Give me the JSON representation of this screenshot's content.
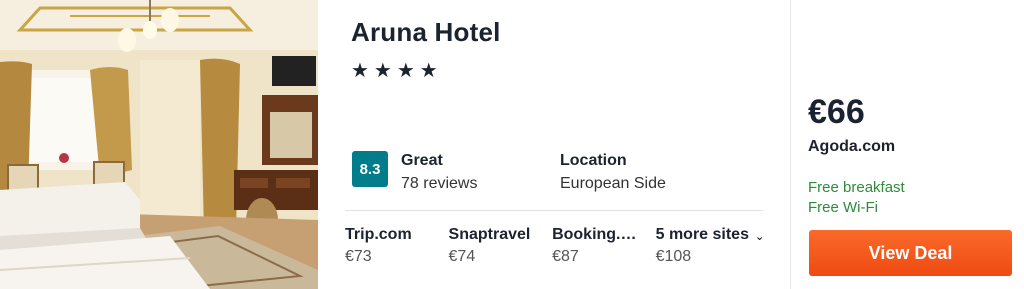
{
  "hotel": {
    "name": "Aruna Hotel",
    "stars_text": "★★★★",
    "star_count": 4
  },
  "rating": {
    "score": "8.3",
    "label": "Great",
    "reviews": "78 reviews",
    "badge_color": "#007c8b"
  },
  "location": {
    "title": "Location",
    "value": "European Side"
  },
  "sites": [
    {
      "name": "Trip.com",
      "price": "€73"
    },
    {
      "name": "Snaptravel",
      "price": "€74"
    },
    {
      "name": "Booking.com",
      "price": "€87"
    }
  ],
  "more_sites": {
    "label": "5 more sites",
    "price": "€108"
  },
  "deal": {
    "price": "€66",
    "provider": "Agoda.com",
    "perks": [
      "Free breakfast",
      "Free Wi-Fi"
    ],
    "button_label": "View Deal",
    "button_color": "#f35a1e",
    "perk_color": "#2f8a3a"
  }
}
